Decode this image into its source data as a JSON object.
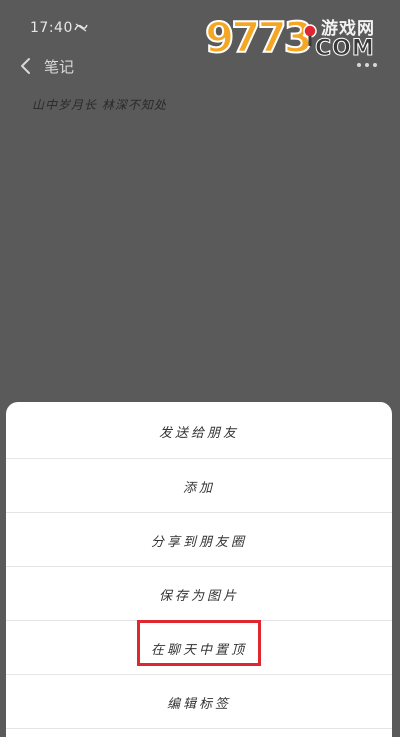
{
  "status_bar": {
    "time": "17:40",
    "icon": "notification-mute-icon"
  },
  "watermark": {
    "digits": "9773",
    "cn_text": "游戏网",
    "com_text": "COM"
  },
  "nav": {
    "back_icon": "back-chevron-icon",
    "title": "笔记",
    "more_icon": "more-dots-icon"
  },
  "note": {
    "text": "山中岁月长 林深不知处"
  },
  "sheet": {
    "items": [
      {
        "label": "发送给朋友"
      },
      {
        "label": "添加"
      },
      {
        "label": "分享到朋友圈"
      },
      {
        "label": "保存为图片"
      },
      {
        "label": "在聊天中置顶"
      },
      {
        "label": "编辑标签"
      }
    ]
  },
  "colors": {
    "overlay": "#5a5a5a",
    "sheet": "#ffffff",
    "highlight": "#e0272f",
    "watermark_orange": "#f5a623"
  }
}
